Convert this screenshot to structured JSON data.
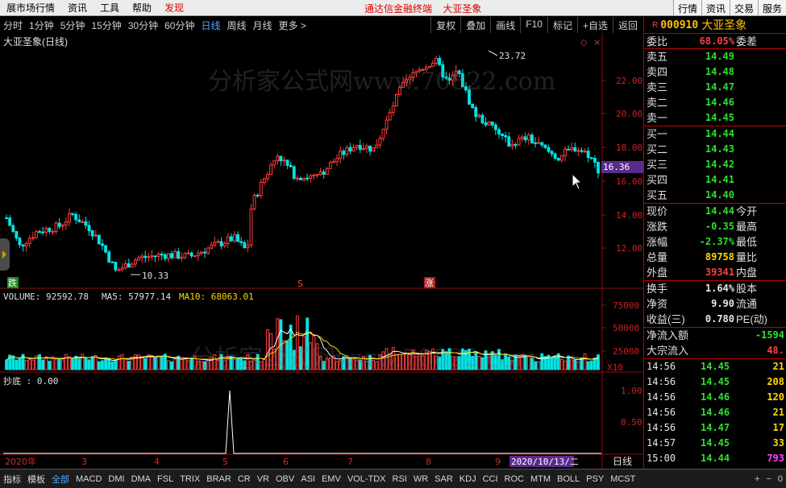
{
  "menubar": {
    "items": [
      "展市场行情",
      "资讯",
      "工具",
      "帮助",
      "发现"
    ],
    "center_title": "通达信金融终端",
    "center_stock": "大亚圣象",
    "right_buttons": [
      "行情",
      "资讯",
      "交易",
      "服务"
    ]
  },
  "periods": {
    "items": [
      "分时",
      "1分钟",
      "5分钟",
      "15分钟",
      "30分钟",
      "60分钟",
      "日线",
      "周线",
      "月线",
      "更多 >"
    ],
    "active": "日线",
    "tools": [
      "复权",
      "叠加",
      "画线",
      "F10",
      "标记",
      "+自选",
      "返回"
    ]
  },
  "chart_title": "大亚圣象(日线)",
  "price_axis": {
    "labels": [
      "22.00",
      "20.00",
      "18.00",
      "16.00",
      "14.00",
      "12.00"
    ]
  },
  "price_annotations": {
    "high": "23.72",
    "low": "10.33",
    "current_tag": "16.36"
  },
  "signal_labels": {
    "die": "跌",
    "s": "S",
    "zhang": "涨"
  },
  "volume_header": {
    "volume": "VOLUME: 92592.78",
    "ma5": "MA5: 57977.14",
    "ma10": "MA10: 68063.01"
  },
  "volume_axis": {
    "labels": [
      "75000",
      "50000",
      "25000"
    ],
    "unit": "X10"
  },
  "indicator_header": "抄底 : 0.00",
  "indicator_axis": {
    "labels": [
      "1.00",
      "0.50"
    ]
  },
  "date_axis": {
    "labels": [
      "2020年",
      "3",
      "4",
      "5",
      "6",
      "7",
      "8",
      "9"
    ],
    "cursor_date": "2020/10/13/二",
    "period": "日线"
  },
  "watermark": "分析家公式网www.70822.com",
  "bottom_tabs": {
    "items": [
      "指标",
      "模板",
      "全部",
      "MACD",
      "DMI",
      "DMA",
      "FSL",
      "TRIX",
      "BRAR",
      "CR",
      "VR",
      "OBV",
      "ASI",
      "EMV",
      "VOL-TDX",
      "RSI",
      "WR",
      "SAR",
      "KDJ",
      "CCI",
      "ROC",
      "MTM",
      "BOLL",
      "PSY",
      "MCST"
    ],
    "active": "全部",
    "nav": [
      "+",
      "−",
      "0"
    ]
  },
  "quote": {
    "code": "000910",
    "name": "大亚圣象",
    "weibi_label": "委比",
    "weibi_value": "68.05%",
    "weicha_label": "委差",
    "asks": [
      {
        "label": "卖五",
        "price": "14.49"
      },
      {
        "label": "卖四",
        "price": "14.48"
      },
      {
        "label": "卖三",
        "price": "14.47"
      },
      {
        "label": "卖二",
        "price": "14.46"
      },
      {
        "label": "卖一",
        "price": "14.45"
      }
    ],
    "bids": [
      {
        "label": "买一",
        "price": "14.44"
      },
      {
        "label": "买二",
        "price": "14.43"
      },
      {
        "label": "买三",
        "price": "14.42"
      },
      {
        "label": "买四",
        "price": "14.41"
      },
      {
        "label": "买五",
        "price": "14.40"
      }
    ],
    "stats": [
      {
        "label": "现价",
        "value": "14.44",
        "label2": "今开",
        "color": "green"
      },
      {
        "label": "涨跌",
        "value": "-0.35",
        "label2": "最高",
        "color": "green"
      },
      {
        "label": "涨幅",
        "value": "-2.37%",
        "label2": "最低",
        "color": "green"
      },
      {
        "label": "总量",
        "value": "89758",
        "label2": "量比",
        "color": "yellow"
      },
      {
        "label": "外盘",
        "value": "39341",
        "label2": "内盘",
        "color": "red"
      }
    ],
    "stats2": [
      {
        "label": "换手",
        "value": "1.64%",
        "label2": "股本"
      },
      {
        "label": "净资",
        "value": "9.90",
        "label2": "流通"
      },
      {
        "label": "收益(三)",
        "value": "0.780",
        "label2": "PE(动)"
      }
    ],
    "flow": [
      {
        "label": "净流入额",
        "value": "-1594",
        "color": "green"
      },
      {
        "label": "大宗流入",
        "value": "48.",
        "color": "red"
      }
    ],
    "ticks": [
      {
        "time": "14:56",
        "price": "14.45",
        "vol": "21",
        "color": "yellow"
      },
      {
        "time": "14:56",
        "price": "14.45",
        "vol": "208",
        "color": "yellow"
      },
      {
        "time": "14:56",
        "price": "14.46",
        "vol": "120",
        "color": "yellow"
      },
      {
        "time": "14:56",
        "price": "14.46",
        "vol": "21",
        "color": "yellow"
      },
      {
        "time": "14:56",
        "price": "14.47",
        "vol": "17",
        "color": "yellow"
      },
      {
        "time": "14:57",
        "price": "14.45",
        "vol": "33",
        "color": "yellow"
      },
      {
        "time": "15:00",
        "price": "14.44",
        "vol": "793",
        "color": "magenta"
      }
    ]
  }
}
